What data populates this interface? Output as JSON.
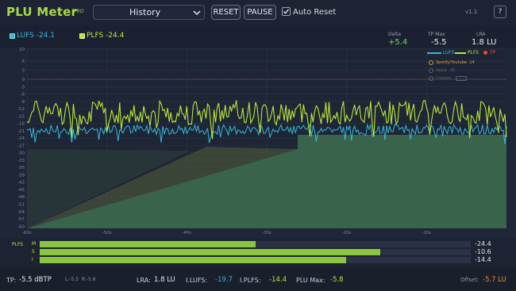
{
  "app": {
    "title": "PLU Meter",
    "edition": "PRO",
    "version": "v1.1"
  },
  "header": {
    "preset": "History",
    "reset": "RESET",
    "pause": "PAUSE",
    "auto_reset": "Auto Reset",
    "auto_reset_checked": true,
    "help": "?"
  },
  "legend_top": {
    "lufs": "LUFS -24.1",
    "plfs": "PLFS -24.4"
  },
  "stats": {
    "delta_label": "Delta",
    "delta_value": "+5.4",
    "tpmax_label": "TP Max",
    "tpmax_value": "-5.5",
    "lra_label": "LRA",
    "lra_value": "1.8 LU"
  },
  "graph": {
    "legend": {
      "lufs": "LUFS",
      "plfs": "PLFS",
      "tp": "TP"
    },
    "targets": [
      {
        "label": "Spotify/Youtube -14",
        "selected": true
      },
      {
        "label": "Apple -16",
        "selected": false
      },
      {
        "label": "Custom",
        "selected": false
      }
    ]
  },
  "chart_data": {
    "type": "line",
    "x_ticks": [
      "-60s",
      "-50s",
      "-40s",
      "-30s",
      "-20s",
      "-10s"
    ],
    "y_ticks": [
      "10",
      "6",
      "3",
      "0",
      "-3",
      "-6",
      "-9",
      "-12",
      "-15",
      "-18",
      "-21",
      "-24",
      "-27",
      "-30",
      "-33",
      "-36",
      "-39",
      "-42",
      "-45",
      "-48",
      "-51",
      "-54",
      "-57",
      "-60"
    ],
    "xlim": [
      -60,
      0
    ],
    "series": [
      {
        "name": "LUFS",
        "color": "#35b8d8"
      },
      {
        "name": "PLFS",
        "color": "#b8e63c"
      }
    ]
  },
  "meters": {
    "label": "PLFS",
    "rows": [
      {
        "name": "M",
        "value": "-24.4",
        "fill": 0.5
      },
      {
        "name": "S",
        "value": "-10.6",
        "fill": 0.79
      },
      {
        "name": "I",
        "value": "-14.4",
        "fill": 0.71
      }
    ]
  },
  "footer": {
    "tp_label": "TP:",
    "tp_value": "-5.5 dBTP",
    "lr": "L:-5.5  R:-5.6",
    "lra_label": "LRA:",
    "lra_value": "1.8 LU",
    "ilufs_label": "I.LUFS:",
    "ilufs_value": "-19.7",
    "iplfs_label": "I.PLFS:",
    "iplfs_value": "-14.4",
    "plumax_label": "PLU Max:",
    "plumax_value": "-5.8",
    "offset_label": "Offset:",
    "offset_value": "-5.7 LU"
  },
  "colors": {
    "accent": "#a8d84a",
    "lufs": "#35b8d8",
    "plfs": "#b8e63c",
    "tp": "#e84b3c",
    "offset": "#f08a2a",
    "bg": "#1b2130"
  }
}
